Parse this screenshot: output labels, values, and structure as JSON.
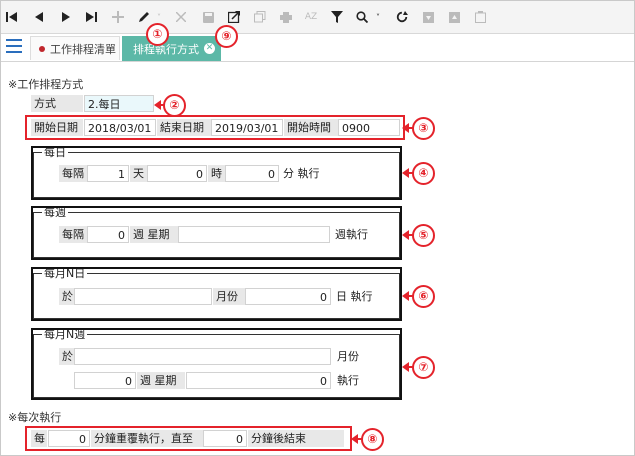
{
  "toolbar": {
    "icons": [
      "first-icon",
      "prev-icon",
      "next-icon",
      "last-icon",
      "add-icon",
      "edit-icon",
      "cancel-icon",
      "save-icon",
      "export-icon",
      "copy-icon",
      "print-icon",
      "sort-icon",
      "filter-icon",
      "search-icon",
      "refresh-icon",
      "import-icon",
      "import2-icon",
      "delete-icon"
    ]
  },
  "tabs": [
    {
      "label": "工作排程清單"
    },
    {
      "label": "排程執行方式"
    }
  ],
  "schedule": {
    "section_title": "※工作排程方式",
    "mode_label": "方式",
    "mode_value": "2.每日",
    "start_date_label": "開始日期",
    "start_date_value": "2018/03/01",
    "end_date_label": "結束日期",
    "end_date_value": "2019/03/01",
    "start_time_label": "開始時間",
    "start_time_value": "0900"
  },
  "daily": {
    "legend": "每日",
    "interval_label": "每隔",
    "day_value": "1",
    "day_unit": "天",
    "hour_value": "0",
    "hour_unit": "時",
    "minute_value": "0",
    "minute_suffix": "分 執行"
  },
  "weekly": {
    "legend": "每週",
    "interval_label": "每隔",
    "week_value": "0",
    "week_unit": "週 星期",
    "weekday_value": "",
    "suffix": "週執行"
  },
  "monthly_n_day": {
    "legend": "每月N日",
    "in_label": "於",
    "in_value": "",
    "month_label": "月份",
    "day_value": "0",
    "day_suffix": "日 執行"
  },
  "monthly_n_week": {
    "legend": "每月N週",
    "in_label": "於",
    "in_value": "",
    "month_suffix": "月份",
    "week_value": "0",
    "week_label": "週 星期",
    "weekday_value": "0",
    "suffix": "執行"
  },
  "repeat": {
    "section_title": "※每次執行",
    "every_label": "每",
    "minute_value": "0",
    "repeat_label": "分鐘重覆執行，直至",
    "until_value": "0",
    "end_label": "分鐘後結束"
  },
  "callouts": [
    "①",
    "②",
    "③",
    "④",
    "⑤",
    "⑥",
    "⑦",
    "⑧",
    "⑨"
  ],
  "colors": {
    "accent": "#5cb8a7",
    "annotation": "#e4232b",
    "menu": "#2a6ebd",
    "tab_dot": "#c0272d"
  }
}
